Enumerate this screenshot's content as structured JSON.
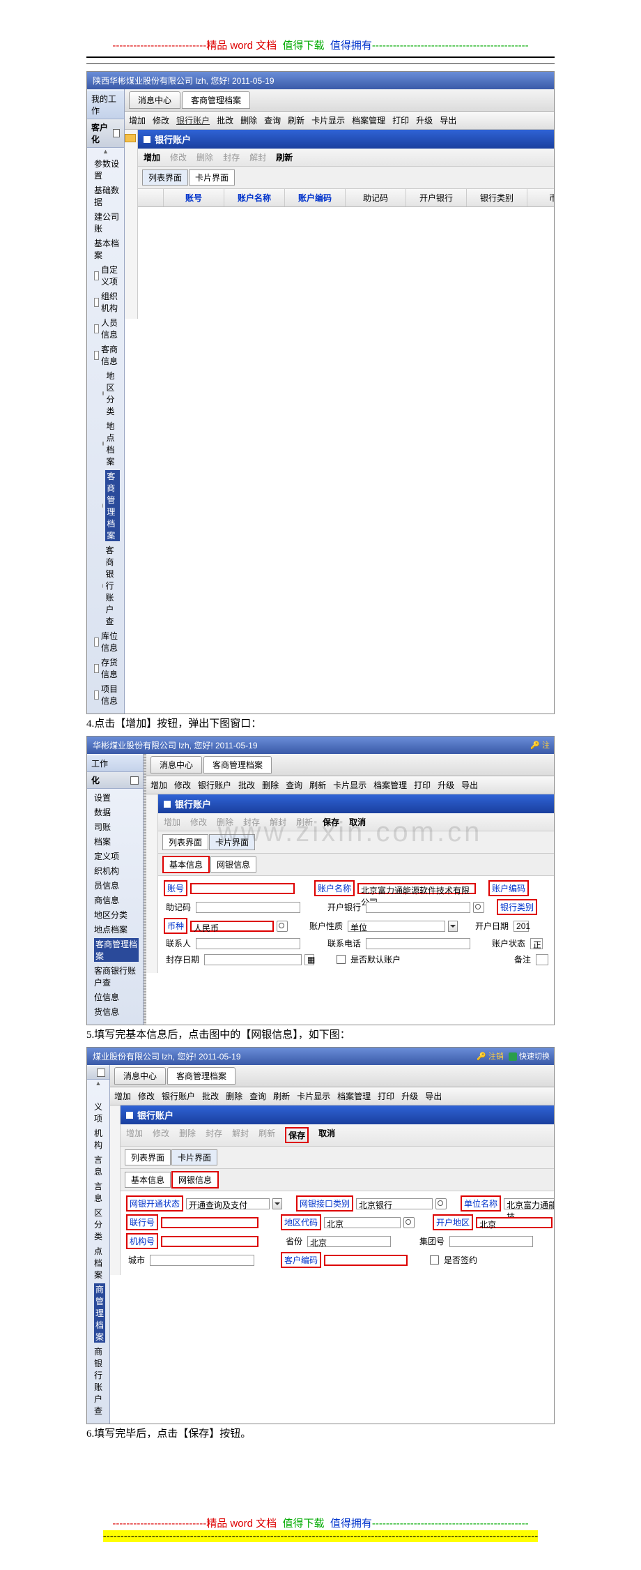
{
  "doc": {
    "header_prefix": "---------------------------",
    "header_red": "精品",
    "header_word": "word",
    "header_file": "文档",
    "header_green": "值得下载",
    "header_blue": "值得拥有",
    "header_dashes": "---------------------------------------------",
    "step4": "4.点击【增加】按钮，弹出下图窗口：",
    "step5": "5.填写完基本信息后，点击图中的【网银信息】，如下图：",
    "step6": "6.填写完毕后，点击【保存】按钮。",
    "footer_dashes2": "-----------------------------------------------------------------------------------------------------------------------------"
  },
  "shot1": {
    "title": "陕西华彬煤业股份有限公司 lzh, 您好! 2011-05-19",
    "side_my_work": "我的工作",
    "side_kehuhua": "客户化",
    "tree": [
      "参数设置",
      "基础数据",
      "建公司账",
      "基本档案",
      "自定义项",
      "组织机构",
      "人员信息",
      "客商信息",
      "地区分类",
      "地点档案",
      "客商管理档案",
      "客商银行账户查",
      "库位信息",
      "存货信息",
      "项目信息"
    ],
    "tabs": [
      "消息中心",
      "客商管理档案"
    ],
    "toolbar": [
      "增加",
      "修改",
      "银行账户",
      "批改",
      "删除",
      "查询",
      "刷新",
      "卡片显示",
      "档案管理",
      "打印",
      "升级",
      "导出"
    ],
    "panel": "银行账户",
    "subtoolbar_enabled": [
      "增加",
      "刷新"
    ],
    "subtoolbar_disabled": [
      "修改",
      "删除",
      "封存",
      "解封"
    ],
    "viewtabs": [
      "列表界面",
      "卡片界面"
    ],
    "grid": [
      "账号",
      "账户名称",
      "账户编码",
      "助记码",
      "开户银行",
      "银行类别",
      "币种"
    ]
  },
  "shot2": {
    "title": "华彬煤业股份有限公司 lzh, 您好! 2011-05-19",
    "right_badge": "注",
    "side_work": "工作",
    "side_hua": "化",
    "tree": [
      "设置",
      "数据",
      "司账",
      "档案",
      "定义项",
      "织机构",
      "员信息",
      "商信息",
      "地区分类",
      "地点档案",
      "客商管理档案",
      "客商银行账户查",
      "位信息",
      "货信息"
    ],
    "tabs": [
      "消息中心",
      "客商管理档案"
    ],
    "toolbar": [
      "增加",
      "修改",
      "银行账户",
      "批改",
      "删除",
      "查询",
      "刷新",
      "卡片显示",
      "档案管理",
      "打印",
      "升级",
      "导出"
    ],
    "panel": "银行账户",
    "subtoolbar_disabled": [
      "增加",
      "修改",
      "删除",
      "封存",
      "解封",
      "刷新"
    ],
    "subtoolbar_enabled": [
      "保存",
      "取消"
    ],
    "viewtabs": [
      "列表界面",
      "卡片界面"
    ],
    "innertabs": [
      "基本信息",
      "网银信息"
    ],
    "form": {
      "zh": "账号",
      "zhv": "",
      "zhmc": "账户名称",
      "zhmcv": "北京富力通能源软件技术有限公司",
      "zhbm": "账户编码",
      "zjm": "助记码",
      "zjmv": "",
      "khyh": "开户银行",
      "khyhv": "",
      "yhlb": "银行类别",
      "bz": "币种",
      "bzv": "人民币",
      "zhxz": "账户性质",
      "zhxzv": "单位",
      "khrq": "开户日期",
      "khrqv": "201",
      "lxr": "联系人",
      "lxrv": "",
      "lxdh": "联系电话",
      "lxdhv": "",
      "zhzt": "账户状态",
      "zhztv": "正",
      "fcrq": "封存日期",
      "fcrqv": "",
      "sfmr": "是否默认账户",
      "beizhu": "备注"
    }
  },
  "shot3": {
    "title": "煤业股份有限公司 lzh, 您好! 2011-05-19",
    "right_logout": "注销",
    "right_switch": "快速切换",
    "tree": [
      "",
      "",
      "",
      "",
      "义项",
      "机构",
      "言息",
      "言息",
      "区分类",
      "点档案",
      "商管理档案",
      "商银行账户查"
    ],
    "tabs": [
      "消息中心",
      "客商管理档案"
    ],
    "toolbar": [
      "增加",
      "修改",
      "银行账户",
      "批改",
      "删除",
      "查询",
      "刷新",
      "卡片显示",
      "档案管理",
      "打印",
      "升级",
      "导出"
    ],
    "panel": "银行账户",
    "subtoolbar_disabled": [
      "增加",
      "修改",
      "删除",
      "封存",
      "解封",
      "刷新"
    ],
    "subtoolbar_enabled": [
      "保存",
      "取消"
    ],
    "viewtabs": [
      "列表界面",
      "卡片界面"
    ],
    "innertabs": [
      "基本信息",
      "网银信息"
    ],
    "form": {
      "wyktzt": "网银开通状态",
      "wyktztv": "开通查询及支付",
      "wyjklb": "网银接口类别",
      "wyjklbv": "北京银行",
      "dwmc": "单位名称",
      "dwmcv": "北京富力通能源软件技",
      "lxh": "联行号",
      "lxhv": "",
      "dqdm": "地区代码",
      "dqdmv": "北京",
      "khdq": "开户地区",
      "khdqv": "北京",
      "jgh": "机构号",
      "jghv": "",
      "sf": "省份",
      "sfv": "北京",
      "jth": "集团号",
      "jthv": "",
      "cshi": "城市",
      "cshiv": "",
      "khbm": "客户编码",
      "khbmv": "",
      "sfqy": "是否签约"
    }
  }
}
